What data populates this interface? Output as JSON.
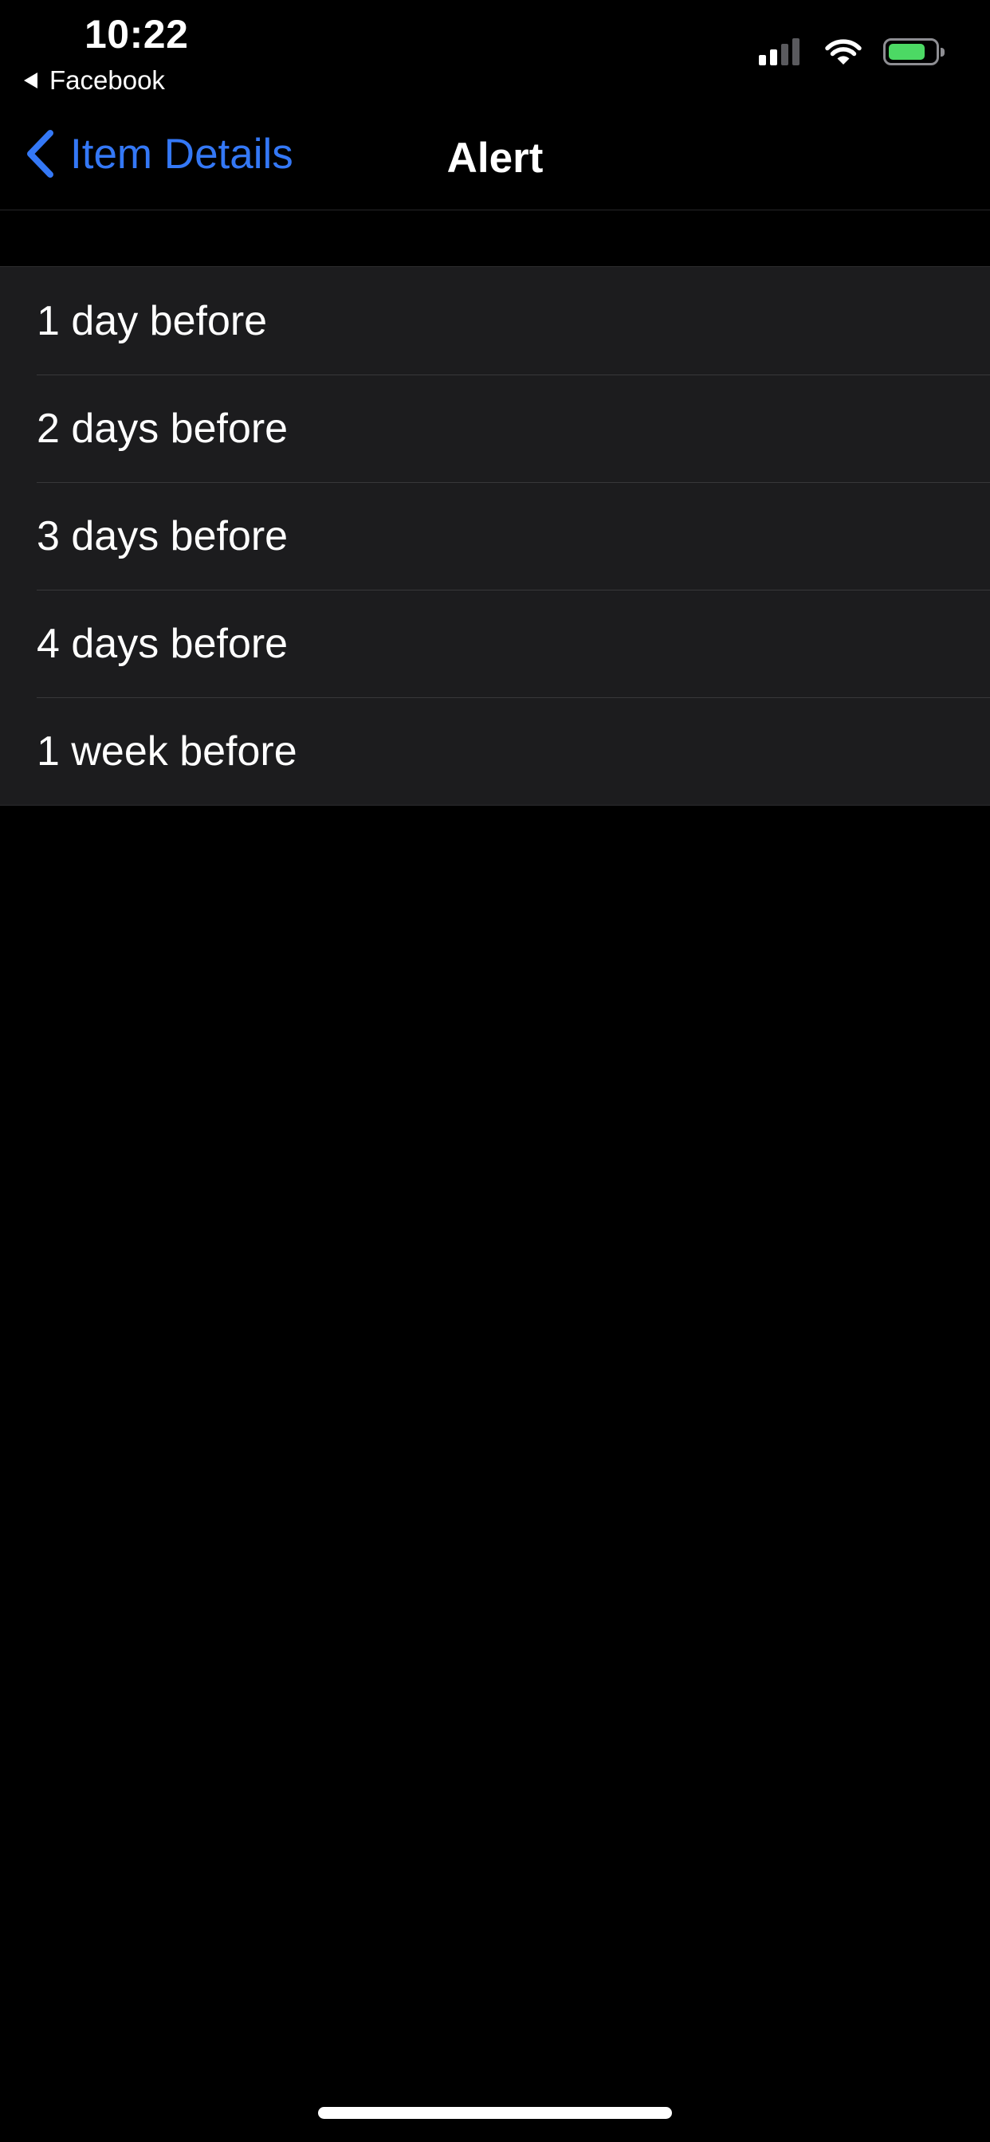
{
  "status_bar": {
    "time": "10:22",
    "back_app": "Facebook",
    "signal_bars_active": 2,
    "signal_bars_total": 4,
    "battery_level": 0.8,
    "battery_color": "#4cd964"
  },
  "nav": {
    "back_label": "Item Details",
    "title": "Alert",
    "accent_color": "#3478f6"
  },
  "options": [
    {
      "label": "1 day before"
    },
    {
      "label": "2 days before"
    },
    {
      "label": "3 days before"
    },
    {
      "label": "4 days before"
    },
    {
      "label": "1 week before"
    }
  ],
  "icons": {
    "back_chevron": "chevron-left-icon",
    "return_app": "triangle-left-icon",
    "signal": "cellular-signal-icon",
    "wifi": "wifi-icon",
    "battery": "battery-icon"
  }
}
